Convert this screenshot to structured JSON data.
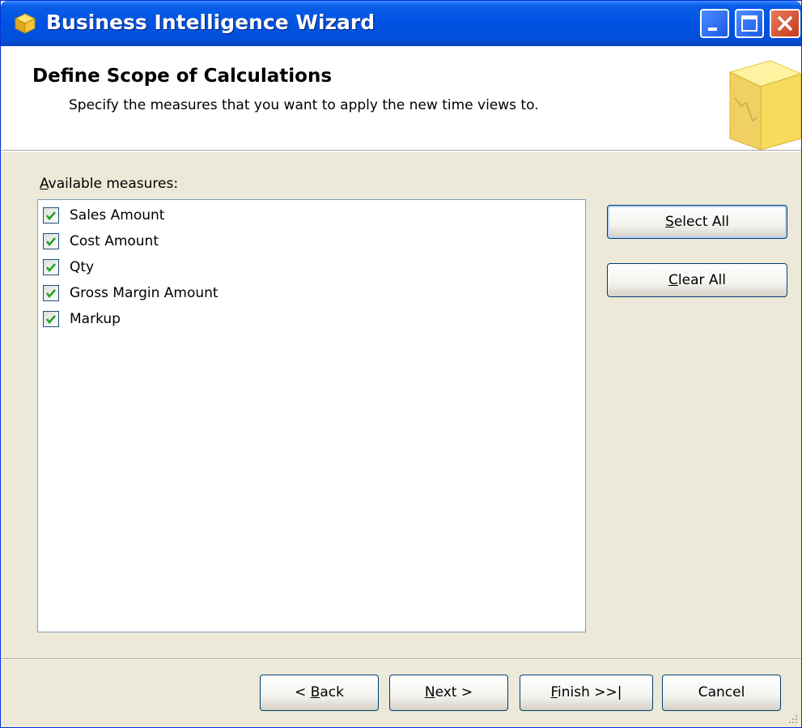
{
  "window": {
    "title": "Business Intelligence Wizard",
    "icon": "cube-icon"
  },
  "header": {
    "title": "Define Scope of Calculations",
    "subtitle": "Specify the measures that you want to apply the new time views to.",
    "graphic": "cube-chart-graphic"
  },
  "measures": {
    "label_mnemonic": "A",
    "label_rest": "vailable measures:",
    "items": [
      {
        "label": "Sales Amount",
        "checked": true
      },
      {
        "label": "Cost Amount",
        "checked": true
      },
      {
        "label": "Qty",
        "checked": true
      },
      {
        "label": "Gross Margin Amount",
        "checked": true
      },
      {
        "label": "Markup",
        "checked": true
      }
    ]
  },
  "actions": {
    "select_all_mnemonic": "S",
    "select_all_rest": "elect All",
    "clear_all_mnemonic": "C",
    "clear_all_rest": "lear All"
  },
  "footer": {
    "back_prefix": "< ",
    "back_mnemonic": "B",
    "back_rest": "ack",
    "next_mnemonic": "N",
    "next_rest": "ext >",
    "finish_mnemonic": "F",
    "finish_rest": "inish >>|",
    "cancel_label": "Cancel"
  },
  "colors": {
    "titlebar": "#0054e3",
    "face": "#ece9d8",
    "check": "#21a121"
  }
}
